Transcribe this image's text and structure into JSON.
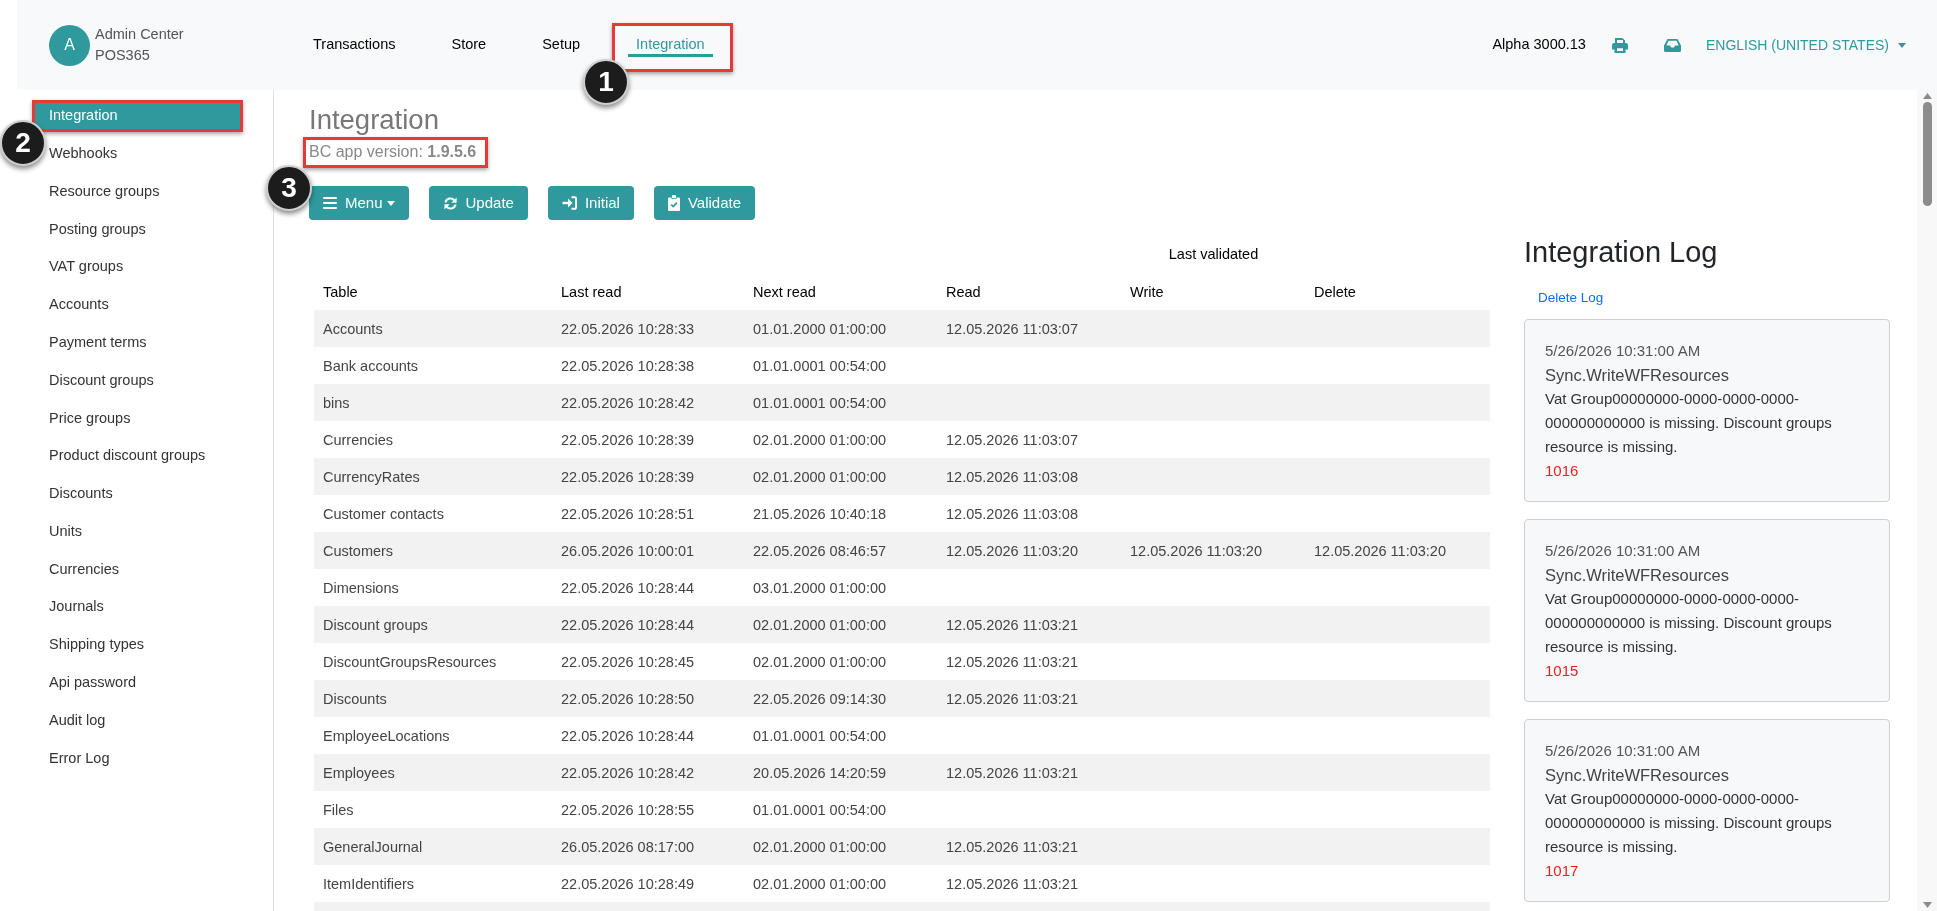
{
  "header": {
    "avatar_initial": "A",
    "app_name": "Admin Center",
    "tenant": "POS365",
    "nav": [
      {
        "label": "Transactions",
        "selected": false
      },
      {
        "label": "Store",
        "selected": false
      },
      {
        "label": "Setup",
        "selected": false
      },
      {
        "label": "Integration",
        "selected": true
      }
    ],
    "version": "Alpha 3000.13",
    "language": "ENGLISH (UNITED STATES)"
  },
  "sidebar": {
    "items": [
      {
        "label": "Integration",
        "selected": true
      },
      {
        "label": "Webhooks",
        "selected": false
      },
      {
        "label": "Resource groups",
        "selected": false
      },
      {
        "label": "Posting groups",
        "selected": false
      },
      {
        "label": "VAT groups",
        "selected": false
      },
      {
        "label": "Accounts",
        "selected": false
      },
      {
        "label": "Payment terms",
        "selected": false
      },
      {
        "label": "Discount groups",
        "selected": false
      },
      {
        "label": "Price groups",
        "selected": false
      },
      {
        "label": "Product discount groups",
        "selected": false
      },
      {
        "label": "Discounts",
        "selected": false
      },
      {
        "label": "Units",
        "selected": false
      },
      {
        "label": "Currencies",
        "selected": false
      },
      {
        "label": "Journals",
        "selected": false
      },
      {
        "label": "Shipping types",
        "selected": false
      },
      {
        "label": "Api password",
        "selected": false
      },
      {
        "label": "Audit log",
        "selected": false
      },
      {
        "label": "Error Log",
        "selected": false
      }
    ]
  },
  "page": {
    "title": "Integration",
    "subtitle": "BC app version: **1.9.5.6**",
    "toolbar": [
      {
        "label": "Menu",
        "kind": "menu",
        "dropdown": true
      },
      {
        "label": "Update",
        "kind": "update",
        "dropdown": false
      },
      {
        "label": "Initial",
        "kind": "initial",
        "dropdown": false
      },
      {
        "label": "Validate",
        "kind": "validate",
        "dropdown": false
      }
    ]
  },
  "table": {
    "group_header": "Last validated",
    "columns": [
      "Table",
      "Last read",
      "Next read",
      "Read",
      "Write",
      "Delete"
    ],
    "rows": [
      {
        "table": "Accounts",
        "last_read": "22.05.2026 10:28:33",
        "next_read": "01.01.2000 01:00:00",
        "read": "12.05.2026 11:03:07"
      },
      {
        "table": "Bank accounts",
        "last_read": "22.05.2026 10:28:38",
        "next_read": "01.01.0001 00:54:00"
      },
      {
        "table": "bins",
        "last_read": "22.05.2026 10:28:42",
        "next_read": "01.01.0001 00:54:00"
      },
      {
        "table": "Currencies",
        "last_read": "22.05.2026 10:28:39",
        "next_read": "02.01.2000 01:00:00",
        "read": "12.05.2026 11:03:07"
      },
      {
        "table": "CurrencyRates",
        "last_read": "22.05.2026 10:28:39",
        "next_read": "02.01.2000 01:00:00",
        "read": "12.05.2026 11:03:08"
      },
      {
        "table": "Customer contacts",
        "last_read": "22.05.2026 10:28:51",
        "next_read": "21.05.2026 10:40:18",
        "read": "12.05.2026 11:03:08"
      },
      {
        "table": "Customers",
        "last_read": "26.05.2026 10:00:01",
        "next_read": "22.05.2026 08:46:57",
        "read": "12.05.2026 11:03:20",
        "write": "12.05.2026 11:03:20",
        "delete": "12.05.2026 11:03:20"
      },
      {
        "table": "Dimensions",
        "last_read": "22.05.2026 10:28:44",
        "next_read": "03.01.2000 01:00:00"
      },
      {
        "table": "Discount groups",
        "last_read": "22.05.2026 10:28:44",
        "next_read": "02.01.2000 01:00:00",
        "read": "12.05.2026 11:03:21"
      },
      {
        "table": "DiscountGroupsResources",
        "last_read": "22.05.2026 10:28:45",
        "next_read": "02.01.2000 01:00:00",
        "read": "12.05.2026 11:03:21"
      },
      {
        "table": "Discounts",
        "last_read": "22.05.2026 10:28:50",
        "next_read": "22.05.2026 09:14:30",
        "read": "12.05.2026 11:03:21"
      },
      {
        "table": "EmployeeLocations",
        "last_read": "22.05.2026 10:28:44",
        "next_read": "01.01.0001 00:54:00"
      },
      {
        "table": "Employees",
        "last_read": "22.05.2026 10:28:42",
        "next_read": "20.05.2026 14:20:59",
        "read": "12.05.2026 11:03:21"
      },
      {
        "table": "Files",
        "last_read": "22.05.2026 10:28:55",
        "next_read": "01.01.0001 00:54:00"
      },
      {
        "table": "GeneralJournal",
        "last_read": "26.05.2026 08:17:00",
        "next_read": "02.01.2000 01:00:00",
        "read": "12.05.2026 11:03:21"
      },
      {
        "table": "ItemIdentifiers",
        "last_read": "22.05.2026 10:28:49",
        "next_read": "02.01.2000 01:00:00",
        "read": "12.05.2026 11:03:21"
      }
    ]
  },
  "log": {
    "title": "Integration Log",
    "delete_link": "Delete Log",
    "entries": [
      {
        "time": "5/26/2026 10:31:00 AM",
        "source": "Sync.WriteWFResources",
        "message": "Vat Group00000000-0000-0000-0000-000000000000 is missing. Discount groups resource is missing.",
        "code": "1016"
      },
      {
        "time": "5/26/2026 10:31:00 AM",
        "source": "Sync.WriteWFResources",
        "message": "Vat Group00000000-0000-0000-0000-000000000000 is missing. Discount groups resource is missing.",
        "code": "1015"
      },
      {
        "time": "5/26/2026 10:31:00 AM",
        "source": "Sync.WriteWFResources",
        "message": "Vat Group00000000-0000-0000-0000-000000000000 is missing. Discount groups resource is missing.",
        "code": "1017"
      }
    ]
  },
  "callouts": [
    {
      "number": "1"
    },
    {
      "number": "2"
    },
    {
      "number": "3"
    }
  ]
}
